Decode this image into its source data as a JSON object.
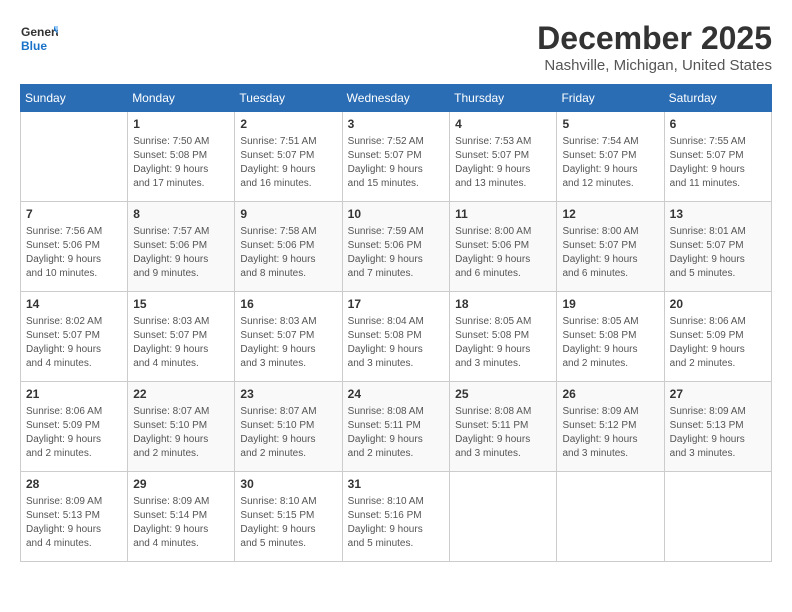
{
  "logo": {
    "line1": "General",
    "line2": "Blue"
  },
  "title": "December 2025",
  "subtitle": "Nashville, Michigan, United States",
  "days_of_week": [
    "Sunday",
    "Monday",
    "Tuesday",
    "Wednesday",
    "Thursday",
    "Friday",
    "Saturday"
  ],
  "weeks": [
    [
      {
        "day": "",
        "info": ""
      },
      {
        "day": "1",
        "info": "Sunrise: 7:50 AM\nSunset: 5:08 PM\nDaylight: 9 hours\nand 17 minutes."
      },
      {
        "day": "2",
        "info": "Sunrise: 7:51 AM\nSunset: 5:07 PM\nDaylight: 9 hours\nand 16 minutes."
      },
      {
        "day": "3",
        "info": "Sunrise: 7:52 AM\nSunset: 5:07 PM\nDaylight: 9 hours\nand 15 minutes."
      },
      {
        "day": "4",
        "info": "Sunrise: 7:53 AM\nSunset: 5:07 PM\nDaylight: 9 hours\nand 13 minutes."
      },
      {
        "day": "5",
        "info": "Sunrise: 7:54 AM\nSunset: 5:07 PM\nDaylight: 9 hours\nand 12 minutes."
      },
      {
        "day": "6",
        "info": "Sunrise: 7:55 AM\nSunset: 5:07 PM\nDaylight: 9 hours\nand 11 minutes."
      }
    ],
    [
      {
        "day": "7",
        "info": "Sunrise: 7:56 AM\nSunset: 5:06 PM\nDaylight: 9 hours\nand 10 minutes."
      },
      {
        "day": "8",
        "info": "Sunrise: 7:57 AM\nSunset: 5:06 PM\nDaylight: 9 hours\nand 9 minutes."
      },
      {
        "day": "9",
        "info": "Sunrise: 7:58 AM\nSunset: 5:06 PM\nDaylight: 9 hours\nand 8 minutes."
      },
      {
        "day": "10",
        "info": "Sunrise: 7:59 AM\nSunset: 5:06 PM\nDaylight: 9 hours\nand 7 minutes."
      },
      {
        "day": "11",
        "info": "Sunrise: 8:00 AM\nSunset: 5:06 PM\nDaylight: 9 hours\nand 6 minutes."
      },
      {
        "day": "12",
        "info": "Sunrise: 8:00 AM\nSunset: 5:07 PM\nDaylight: 9 hours\nand 6 minutes."
      },
      {
        "day": "13",
        "info": "Sunrise: 8:01 AM\nSunset: 5:07 PM\nDaylight: 9 hours\nand 5 minutes."
      }
    ],
    [
      {
        "day": "14",
        "info": "Sunrise: 8:02 AM\nSunset: 5:07 PM\nDaylight: 9 hours\nand 4 minutes."
      },
      {
        "day": "15",
        "info": "Sunrise: 8:03 AM\nSunset: 5:07 PM\nDaylight: 9 hours\nand 4 minutes."
      },
      {
        "day": "16",
        "info": "Sunrise: 8:03 AM\nSunset: 5:07 PM\nDaylight: 9 hours\nand 3 minutes."
      },
      {
        "day": "17",
        "info": "Sunrise: 8:04 AM\nSunset: 5:08 PM\nDaylight: 9 hours\nand 3 minutes."
      },
      {
        "day": "18",
        "info": "Sunrise: 8:05 AM\nSunset: 5:08 PM\nDaylight: 9 hours\nand 3 minutes."
      },
      {
        "day": "19",
        "info": "Sunrise: 8:05 AM\nSunset: 5:08 PM\nDaylight: 9 hours\nand 2 minutes."
      },
      {
        "day": "20",
        "info": "Sunrise: 8:06 AM\nSunset: 5:09 PM\nDaylight: 9 hours\nand 2 minutes."
      }
    ],
    [
      {
        "day": "21",
        "info": "Sunrise: 8:06 AM\nSunset: 5:09 PM\nDaylight: 9 hours\nand 2 minutes."
      },
      {
        "day": "22",
        "info": "Sunrise: 8:07 AM\nSunset: 5:10 PM\nDaylight: 9 hours\nand 2 minutes."
      },
      {
        "day": "23",
        "info": "Sunrise: 8:07 AM\nSunset: 5:10 PM\nDaylight: 9 hours\nand 2 minutes."
      },
      {
        "day": "24",
        "info": "Sunrise: 8:08 AM\nSunset: 5:11 PM\nDaylight: 9 hours\nand 2 minutes."
      },
      {
        "day": "25",
        "info": "Sunrise: 8:08 AM\nSunset: 5:11 PM\nDaylight: 9 hours\nand 3 minutes."
      },
      {
        "day": "26",
        "info": "Sunrise: 8:09 AM\nSunset: 5:12 PM\nDaylight: 9 hours\nand 3 minutes."
      },
      {
        "day": "27",
        "info": "Sunrise: 8:09 AM\nSunset: 5:13 PM\nDaylight: 9 hours\nand 3 minutes."
      }
    ],
    [
      {
        "day": "28",
        "info": "Sunrise: 8:09 AM\nSunset: 5:13 PM\nDaylight: 9 hours\nand 4 minutes."
      },
      {
        "day": "29",
        "info": "Sunrise: 8:09 AM\nSunset: 5:14 PM\nDaylight: 9 hours\nand 4 minutes."
      },
      {
        "day": "30",
        "info": "Sunrise: 8:10 AM\nSunset: 5:15 PM\nDaylight: 9 hours\nand 5 minutes."
      },
      {
        "day": "31",
        "info": "Sunrise: 8:10 AM\nSunset: 5:16 PM\nDaylight: 9 hours\nand 5 minutes."
      },
      {
        "day": "",
        "info": ""
      },
      {
        "day": "",
        "info": ""
      },
      {
        "day": "",
        "info": ""
      }
    ]
  ]
}
